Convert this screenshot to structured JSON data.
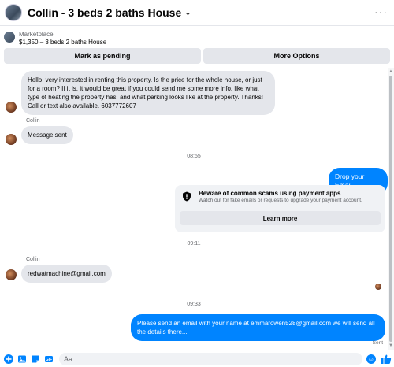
{
  "header": {
    "title": "Collin - 3 beds 2 baths House"
  },
  "marketplace": {
    "label": "Marketplace",
    "listing": "$1,350 – 3 beds 2 baths House",
    "pending_button": "Mark as pending",
    "more_button": "More Options"
  },
  "messages": {
    "m1": "Hello, very interested in renting this property. Is the price for the whole house, or just for a room?  If it is, it would be great if you could send me some more info, like what type of heating the property has, and what parking looks like at the property. Thanks! Call or text also available. 6037772607",
    "sender1": "Collin",
    "m2": "Message sent",
    "time1": "08:55",
    "m3": "Drop your Email",
    "notice_title": "Beware of common scams using payment apps",
    "notice_text": "Watch out for fake emails or requests to upgrade your payment account.",
    "notice_button": "Learn more",
    "time2": "09:11",
    "sender2": "Collin",
    "m4": "redwatmachine@gmail.com",
    "time3": "09:33",
    "m5": "Please send an email with your name at emmarowen528@gmail.com we will send all the details there...",
    "sent_status": "Sent"
  },
  "composer": {
    "placeholder": "Aa"
  },
  "colors": {
    "accent": "#0084ff",
    "incoming_bubble": "#e4e6eb"
  }
}
